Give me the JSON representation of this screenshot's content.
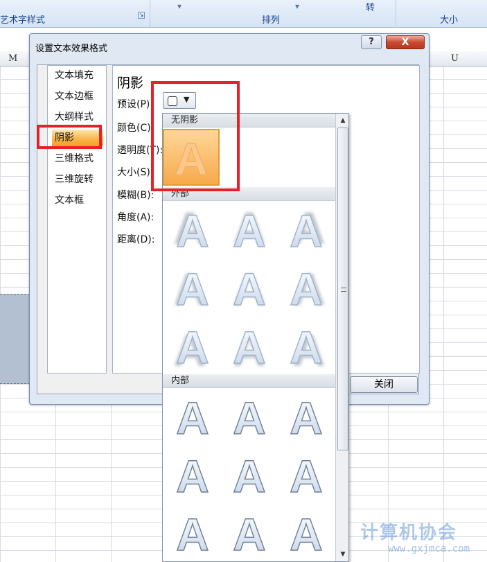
{
  "ribbon": {
    "group_wordart": "艺术字样式",
    "group_arrange": "排列",
    "group_size": "大小",
    "rotate_label": "转"
  },
  "columns": [
    "M",
    "U"
  ],
  "dialog": {
    "title": "设置文本效果格式",
    "help_label": "?",
    "close_x": "X",
    "nav": [
      "文本填充",
      "文本边框",
      "大纲样式",
      "阴影",
      "三维格式",
      "三维旋转",
      "文本框"
    ],
    "selected_nav": "阴影",
    "heading": "阴影",
    "fields": [
      "预设(P):",
      "颜色(C):",
      "透明度(T):",
      "大小(S):",
      "模糊(B):",
      "角度(A):",
      "距离(D):"
    ],
    "close_button": "关闭"
  },
  "gallery": {
    "sections": [
      "无阴影",
      "外部",
      "内部"
    ],
    "tile_letter": "A",
    "accent_color": "#f7a94a",
    "highlight_color": "#e62127"
  },
  "watermark": {
    "text": "计算机协会",
    "url": "www.gxjmca.com"
  }
}
